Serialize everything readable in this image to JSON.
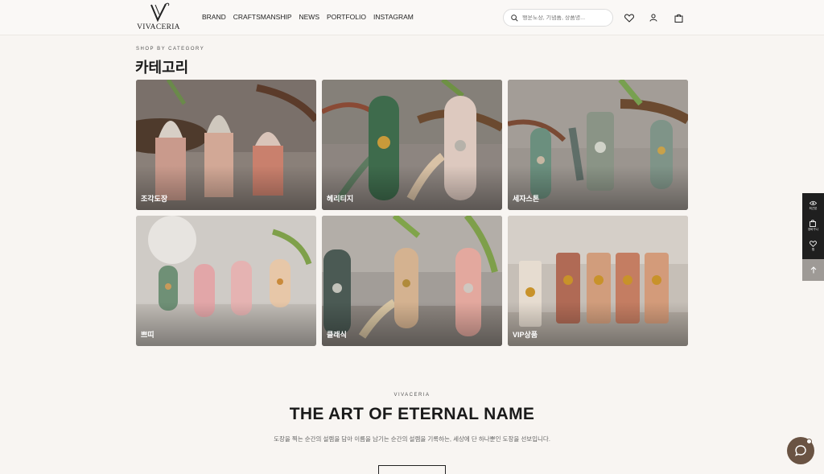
{
  "header": {
    "logo_text": "VIVACERIA",
    "nav": [
      "BRAND",
      "CRAFTSMANSHIP",
      "NEWS",
      "PORTFOLIO",
      "INSTAGRAM"
    ],
    "search_placeholder": "행운도장, 기념품, 상품명..."
  },
  "category": {
    "eyebrow": "SHOP BY CATEGORY",
    "title": "카테고리",
    "cards": [
      {
        "label": "조각도장",
        "bg": "#8a8079"
      },
      {
        "label": "헤리티지",
        "bg": "#8d8580"
      },
      {
        "label": "세자스톤",
        "bg": "#9b958f"
      },
      {
        "label": "쁘띠",
        "bg": "#cfcbc6"
      },
      {
        "label": "클래식",
        "bg": "#a29d98"
      },
      {
        "label": "VIP상품",
        "bg": "#c6bfb7"
      }
    ]
  },
  "brand": {
    "eyebrow": "VIVACERIA",
    "title": "THE ART OF ETERNAL NAME",
    "description": "도장을 찍는 순간의 설렘을 담아 이름을 남기는 순간의 설렘을 기록하는, 세상에 단 하나뿐인 도장을 선보입니다."
  },
  "quick_menu": {
    "items": [
      "최근본",
      "장바구니",
      "찜"
    ]
  },
  "colors": {
    "background": "#f8f5f2",
    "quick_menu": "#1f1f1f",
    "chat_button": "#6a5343"
  }
}
